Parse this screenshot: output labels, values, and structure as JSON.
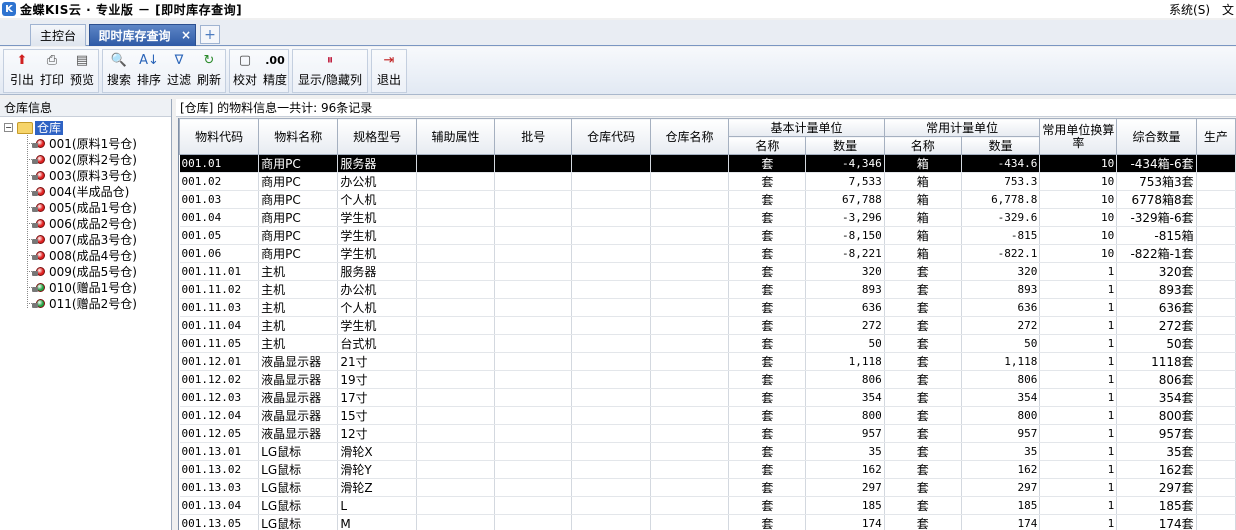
{
  "app": {
    "logo_glyph": "K",
    "title": "金蝶KIS云 · 专业版 － [即时库存查询]",
    "menu_system": "系统(S)",
    "menu_more": "文"
  },
  "tabs": [
    {
      "label": "主控台"
    },
    {
      "label": "即时库存查询"
    }
  ],
  "tab_close": "×",
  "tab_add": "+",
  "toolbar": [
    {
      "label": "引出",
      "icon": "export-icon",
      "glyph": "⬆",
      "color": "#d02020"
    },
    {
      "label": "打印",
      "icon": "print-icon",
      "glyph": "⎙",
      "color": "#444"
    },
    {
      "label": "预览",
      "icon": "preview-icon",
      "glyph": "▤",
      "color": "#555"
    },
    {
      "label": "搜索",
      "icon": "search-icon",
      "glyph": "🔍",
      "color": "#2a64b8"
    },
    {
      "label": "排序",
      "icon": "sort-icon",
      "glyph": "A↓",
      "color": "#2a64b8"
    },
    {
      "label": "过滤",
      "icon": "filter-icon",
      "glyph": "∇",
      "color": "#2a64b8"
    },
    {
      "label": "刷新",
      "icon": "refresh-icon",
      "glyph": "↻",
      "color": "#2a8a2a"
    },
    {
      "label": "校对",
      "icon": "check-icon",
      "glyph": "▢",
      "color": "#444"
    },
    {
      "label": "精度",
      "icon": "precision-icon",
      "glyph": ".00",
      "color": "#000"
    },
    {
      "label": "显示/隐藏列",
      "icon": "columns-icon",
      "glyph": "⏸",
      "color": "#c02040"
    },
    {
      "label": "退出",
      "icon": "exit-icon",
      "glyph": "⇥",
      "color": "#c02020"
    }
  ],
  "left_panel": {
    "header": "仓库信息",
    "root": "仓库",
    "expander": "−",
    "items": [
      {
        "label": "001(原料1号仓)",
        "color": "#e02020"
      },
      {
        "label": "002(原料2号仓)",
        "color": "#e02020"
      },
      {
        "label": "003(原料3号仓)",
        "color": "#e02020"
      },
      {
        "label": "004(半成品仓)",
        "color": "#e02020"
      },
      {
        "label": "005(成品1号仓)",
        "color": "#e02020"
      },
      {
        "label": "006(成品2号仓)",
        "color": "#e02020"
      },
      {
        "label": "007(成品3号仓)",
        "color": "#e02020"
      },
      {
        "label": "008(成品4号仓)",
        "color": "#e02020"
      },
      {
        "label": "009(成品5号仓)",
        "color": "#e02020"
      },
      {
        "label": "010(赠品1号仓)",
        "color": "#20a040"
      },
      {
        "label": "011(赠品2号仓)",
        "color": "#20a040"
      }
    ]
  },
  "info_text": "[仓库]  的物料信息一共计: 96条记录",
  "grid": {
    "headers": {
      "code": "物料代码",
      "name": "物料名称",
      "spec": "规格型号",
      "aux": "辅助属性",
      "batch": "批号",
      "wh_code": "仓库代码",
      "wh_name": "仓库名称",
      "base_unit": "基本计量单位",
      "common_unit": "常用计量单位",
      "unit_name": "名称",
      "qty": "数量",
      "rate": "常用单位换算率",
      "combined": "综合数量",
      "more": "生产"
    },
    "rows": [
      [
        "001.01",
        "商用PC",
        "服务器",
        "",
        "",
        "",
        "",
        "套",
        "-4,346",
        "箱",
        "-434.6",
        "10",
        "-434箱-6套"
      ],
      [
        "001.02",
        "商用PC",
        "办公机",
        "",
        "",
        "",
        "",
        "套",
        "7,533",
        "箱",
        "753.3",
        "10",
        "753箱3套"
      ],
      [
        "001.03",
        "商用PC",
        "个人机",
        "",
        "",
        "",
        "",
        "套",
        "67,788",
        "箱",
        "6,778.8",
        "10",
        "6778箱8套"
      ],
      [
        "001.04",
        "商用PC",
        "学生机",
        "",
        "",
        "",
        "",
        "套",
        "-3,296",
        "箱",
        "-329.6",
        "10",
        "-329箱-6套"
      ],
      [
        "001.05",
        "商用PC",
        "学生机",
        "",
        "",
        "",
        "",
        "套",
        "-8,150",
        "箱",
        "-815",
        "10",
        "-815箱"
      ],
      [
        "001.06",
        "商用PC",
        "学生机",
        "",
        "",
        "",
        "",
        "套",
        "-8,221",
        "箱",
        "-822.1",
        "10",
        "-822箱-1套"
      ],
      [
        "001.11.01",
        "主机",
        "服务器",
        "",
        "",
        "",
        "",
        "套",
        "320",
        "套",
        "320",
        "1",
        "320套"
      ],
      [
        "001.11.02",
        "主机",
        "办公机",
        "",
        "",
        "",
        "",
        "套",
        "893",
        "套",
        "893",
        "1",
        "893套"
      ],
      [
        "001.11.03",
        "主机",
        "个人机",
        "",
        "",
        "",
        "",
        "套",
        "636",
        "套",
        "636",
        "1",
        "636套"
      ],
      [
        "001.11.04",
        "主机",
        "学生机",
        "",
        "",
        "",
        "",
        "套",
        "272",
        "套",
        "272",
        "1",
        "272套"
      ],
      [
        "001.11.05",
        "主机",
        "台式机",
        "",
        "",
        "",
        "",
        "套",
        "50",
        "套",
        "50",
        "1",
        "50套"
      ],
      [
        "001.12.01",
        "液晶显示器",
        "21寸",
        "",
        "",
        "",
        "",
        "套",
        "1,118",
        "套",
        "1,118",
        "1",
        "1118套"
      ],
      [
        "001.12.02",
        "液晶显示器",
        "19寸",
        "",
        "",
        "",
        "",
        "套",
        "806",
        "套",
        "806",
        "1",
        "806套"
      ],
      [
        "001.12.03",
        "液晶显示器",
        "17寸",
        "",
        "",
        "",
        "",
        "套",
        "354",
        "套",
        "354",
        "1",
        "354套"
      ],
      [
        "001.12.04",
        "液晶显示器",
        "15寸",
        "",
        "",
        "",
        "",
        "套",
        "800",
        "套",
        "800",
        "1",
        "800套"
      ],
      [
        "001.12.05",
        "液晶显示器",
        "12寸",
        "",
        "",
        "",
        "",
        "套",
        "957",
        "套",
        "957",
        "1",
        "957套"
      ],
      [
        "001.13.01",
        "LG鼠标",
        "滑轮X",
        "",
        "",
        "",
        "",
        "套",
        "35",
        "套",
        "35",
        "1",
        "35套"
      ],
      [
        "001.13.02",
        "LG鼠标",
        "滑轮Y",
        "",
        "",
        "",
        "",
        "套",
        "162",
        "套",
        "162",
        "1",
        "162套"
      ],
      [
        "001.13.03",
        "LG鼠标",
        "滑轮Z",
        "",
        "",
        "",
        "",
        "套",
        "297",
        "套",
        "297",
        "1",
        "297套"
      ],
      [
        "001.13.04",
        "LG鼠标",
        "L",
        "",
        "",
        "",
        "",
        "套",
        "185",
        "套",
        "185",
        "1",
        "185套"
      ],
      [
        "001.13.05",
        "LG鼠标",
        "M",
        "",
        "",
        "",
        "",
        "套",
        "174",
        "套",
        "174",
        "1",
        "174套"
      ]
    ]
  }
}
